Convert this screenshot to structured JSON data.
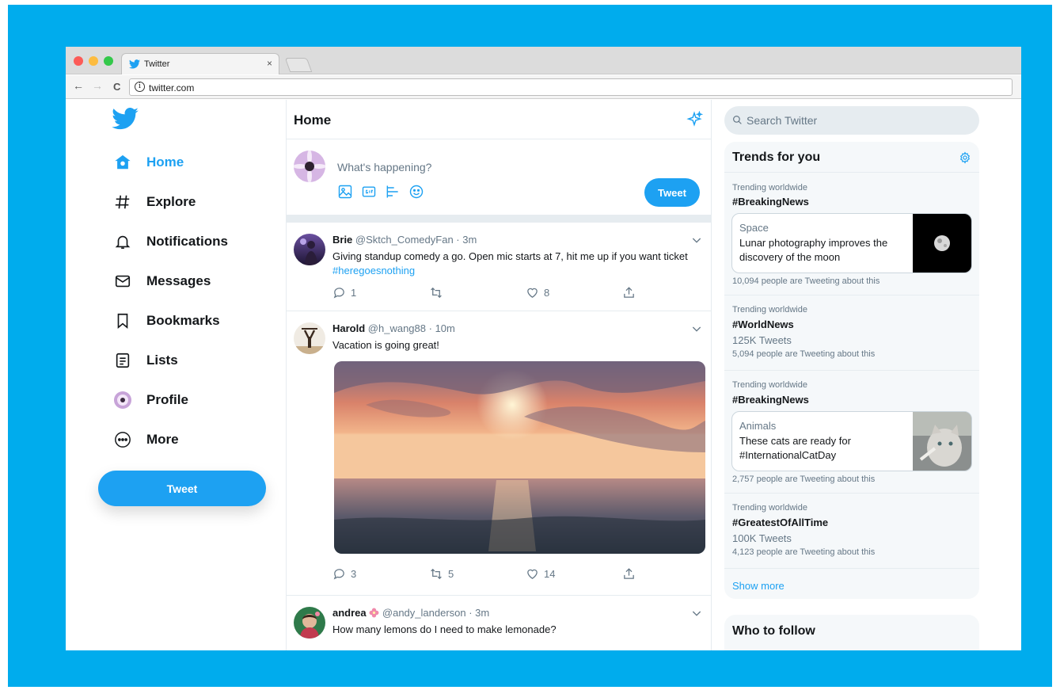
{
  "browser": {
    "tab_title": "Twitter",
    "tab_close": "×",
    "url": "twitter.com",
    "info_glyph": "i",
    "back": "←",
    "forward": "→",
    "reload": "C"
  },
  "sidebar": {
    "items": [
      {
        "label": "Home",
        "icon": "home-icon"
      },
      {
        "label": "Explore",
        "icon": "hashtag-icon"
      },
      {
        "label": "Notifications",
        "icon": "bell-icon"
      },
      {
        "label": "Messages",
        "icon": "envelope-icon"
      },
      {
        "label": "Bookmarks",
        "icon": "bookmark-icon"
      },
      {
        "label": "Lists",
        "icon": "list-icon"
      },
      {
        "label": "Profile",
        "icon": "avatar"
      },
      {
        "label": "More",
        "icon": "more-icon"
      }
    ],
    "tweet_button": "Tweet"
  },
  "timeline": {
    "title": "Home",
    "compose": {
      "placeholder": "What's happening?",
      "tweet_button": "Tweet"
    },
    "tweets": [
      {
        "name": "Brie",
        "handle": "@Sktch_ComedyFan",
        "time": "· 3m",
        "text": "Giving standup comedy a go. Open mic starts at 7, hit me up if you want ticket ",
        "hashtag": "#heregoesnothing",
        "replies": "1",
        "retweets": "",
        "likes": "8"
      },
      {
        "name": "Harold",
        "handle": "@h_wang88",
        "time": "· 10m",
        "text": "Vacation is going great!",
        "replies": "3",
        "retweets": "5",
        "likes": "14"
      },
      {
        "name": "andrea",
        "handle": "@andy_landerson",
        "time": "· 3m",
        "text": "How many lemons do I need to make lemonade?"
      }
    ]
  },
  "right": {
    "search_placeholder": "Search Twitter",
    "trends_title": "Trends for you",
    "trends": [
      {
        "context": "Trending worldwide",
        "tag": "#BreakingNews",
        "card": {
          "category": "Space",
          "text": "Lunar photography improves the discovery of the moon"
        },
        "people": "10,094 people are Tweeting about this"
      },
      {
        "context": "Trending worldwide",
        "tag": "#WorldNews",
        "count": "125K Tweets",
        "people": "5,094 people are Tweeting about this"
      },
      {
        "context": "Trending worldwide",
        "tag": "#BreakingNews",
        "card": {
          "category": "Animals",
          "text": "These cats are ready for #InternationalCatDay"
        },
        "people": "2,757 people are Tweeting about this"
      },
      {
        "context": "Trending worldwide",
        "tag": "#GreatestOfAllTime",
        "count": "100K Tweets",
        "people": "4,123 people are Tweeting about this"
      }
    ],
    "show_more": "Show more",
    "who_to_follow": "Who to follow"
  },
  "colors": {
    "brand": "#1da1f2",
    "frame": "#00aced",
    "text": "#14171a",
    "muted": "#657786"
  }
}
